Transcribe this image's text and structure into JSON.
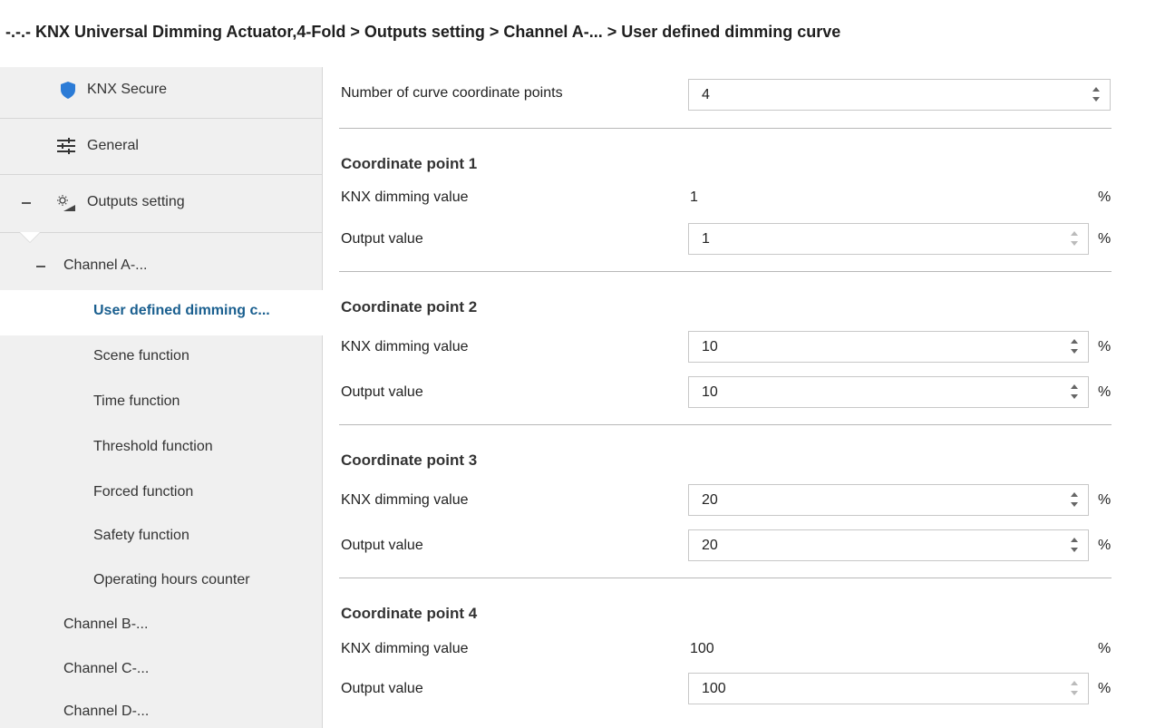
{
  "header": {
    "breadcrumb": "-.-.- KNX Universal Dimming Actuator,4-Fold > Outputs setting > Channel A-... > User defined dimming curve"
  },
  "sidebar": {
    "items": [
      {
        "label": "KNX Secure",
        "icon": "shield-icon"
      },
      {
        "label": "General",
        "icon": "sliders-icon"
      },
      {
        "label": "Outputs setting",
        "icon": "outputs-icon"
      },
      {
        "label": "Channel A-..."
      },
      {
        "label": "User defined dimming c..."
      },
      {
        "label": "Scene function"
      },
      {
        "label": "Time function"
      },
      {
        "label": "Threshold function"
      },
      {
        "label": "Forced function"
      },
      {
        "label": "Safety function"
      },
      {
        "label": "Operating hours counter"
      },
      {
        "label": "Channel B-..."
      },
      {
        "label": "Channel C-..."
      },
      {
        "label": "Channel D-..."
      }
    ]
  },
  "main": {
    "num_points": {
      "label": "Number of curve coordinate points",
      "value": "4"
    },
    "unit": "%",
    "points": [
      {
        "title": "Coordinate point 1",
        "knx_label": "KNX dimming value",
        "knx_value": "1",
        "out_label": "Output value",
        "out_value": "1"
      },
      {
        "title": "Coordinate point 2",
        "knx_label": "KNX dimming value",
        "knx_value": "10",
        "out_label": "Output value",
        "out_value": "10"
      },
      {
        "title": "Coordinate point 3",
        "knx_label": "KNX dimming value",
        "knx_value": "20",
        "out_label": "Output value",
        "out_value": "20"
      },
      {
        "title": "Coordinate point 4",
        "knx_label": "KNX dimming value",
        "knx_value": "100",
        "out_label": "Output value",
        "out_value": "100"
      }
    ]
  },
  "colors": {
    "accent": "#1a5f8f",
    "shield": "#2b7bd6",
    "sidebar_bg": "#f0f0f0"
  }
}
